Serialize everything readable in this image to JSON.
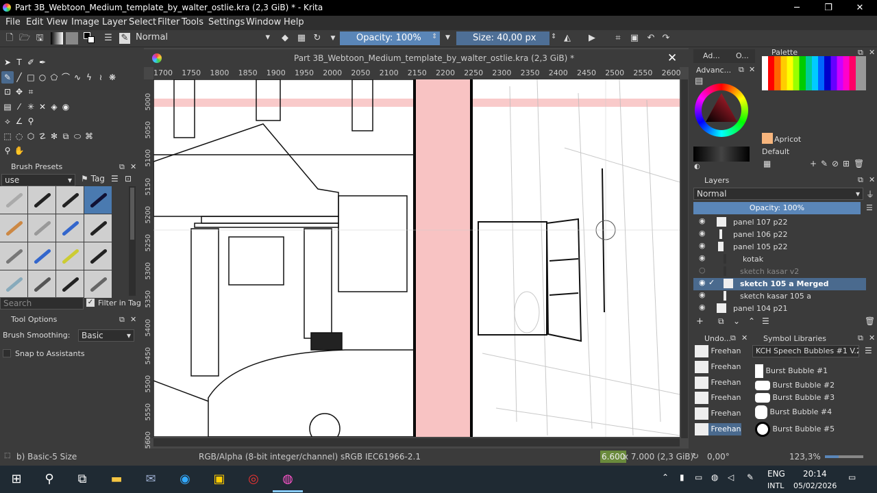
{
  "window": {
    "title": "Part 3B_Webtoon_Medium_template_by_walter_ostlie.kra (2,3 GiB) * - Krita"
  },
  "menu": [
    "File",
    "Edit",
    "View",
    "Image",
    "Layer",
    "Select",
    "Filter",
    "Tools",
    "Settings",
    "Window",
    "Help"
  ],
  "toolbar": {
    "blend_mode": "Normal",
    "opacity": "Opacity: 100%",
    "size": "Size: 40,00 px"
  },
  "brush_presets": {
    "title": "Brush Presets",
    "filter": "use",
    "tag": "Tag",
    "search_placeholder": "Search",
    "filter_in_tag": "Filter in Tag"
  },
  "tool_options": {
    "title": "Tool Options",
    "smoothing_label": "Brush Smoothing:",
    "smoothing_value": "Basic",
    "snap_label": "Snap to Assistants"
  },
  "document_tab": {
    "title": "Part 3B_Webtoon_Medium_template_by_walter_ostlie.kra (2,3 GiB) *"
  },
  "ruler": {
    "h": [
      "1700",
      "1750",
      "1800",
      "1850",
      "1900",
      "1950",
      "2000",
      "2050",
      "2100",
      "2150",
      "2200",
      "2250",
      "2300",
      "2350",
      "2400",
      "2450",
      "2500",
      "2550",
      "2600"
    ],
    "v": [
      "5000",
      "5050",
      "5100",
      "5150",
      "5200",
      "5250",
      "5300",
      "5350",
      "5400",
      "5450",
      "5500",
      "5550",
      "5600"
    ]
  },
  "right_tabs": {
    "tab1": "Ad...",
    "tab2": "O..."
  },
  "advanced_color": {
    "title": "Advanc..."
  },
  "palette": {
    "title": "Palette",
    "color_name": "Apricot",
    "palette_name": "Default",
    "apricot_color": "#f7b57d"
  },
  "layers": {
    "title": "Layers",
    "blend_mode": "Normal",
    "opacity": "Opacity:  100%",
    "items": [
      {
        "name": "panel 107 p22"
      },
      {
        "name": "panel 106 p22"
      },
      {
        "name": "panel 105 p22"
      },
      {
        "name": "kotak"
      },
      {
        "name": "sketch kasar v2"
      },
      {
        "name": "sketch 105 a Merged"
      },
      {
        "name": "sketch kasar 105 a"
      },
      {
        "name": "panel 104 p21"
      }
    ]
  },
  "undo": {
    "title": "Undo...",
    "items": [
      "Freehan",
      "Freehan",
      "Freehan",
      "Freehan",
      "Freehan",
      "Freehan"
    ]
  },
  "symbols": {
    "title": "Symbol Libraries",
    "library": "KCH Speech Bubbles #1 V.2.",
    "items": [
      "Burst Bubble #1",
      "Burst Bubble #2",
      "Burst Bubble #3",
      "Burst Bubble #4",
      "Burst Bubble #5"
    ]
  },
  "status": {
    "brush": "b) Basic-5 Size",
    "colorspace": "RGB/Alpha (8-bit integer/channel)  sRGB IEC61966-2.1",
    "dims_w": "6.600",
    "dims_rest": " x 7.000 (2,3 GiB)",
    "rotation": "0,00°",
    "zoom": "123,3%"
  },
  "taskbar": {
    "lang": "ENG",
    "lang2": "INTL",
    "time": "20:14",
    "date": "05/02/2026"
  }
}
